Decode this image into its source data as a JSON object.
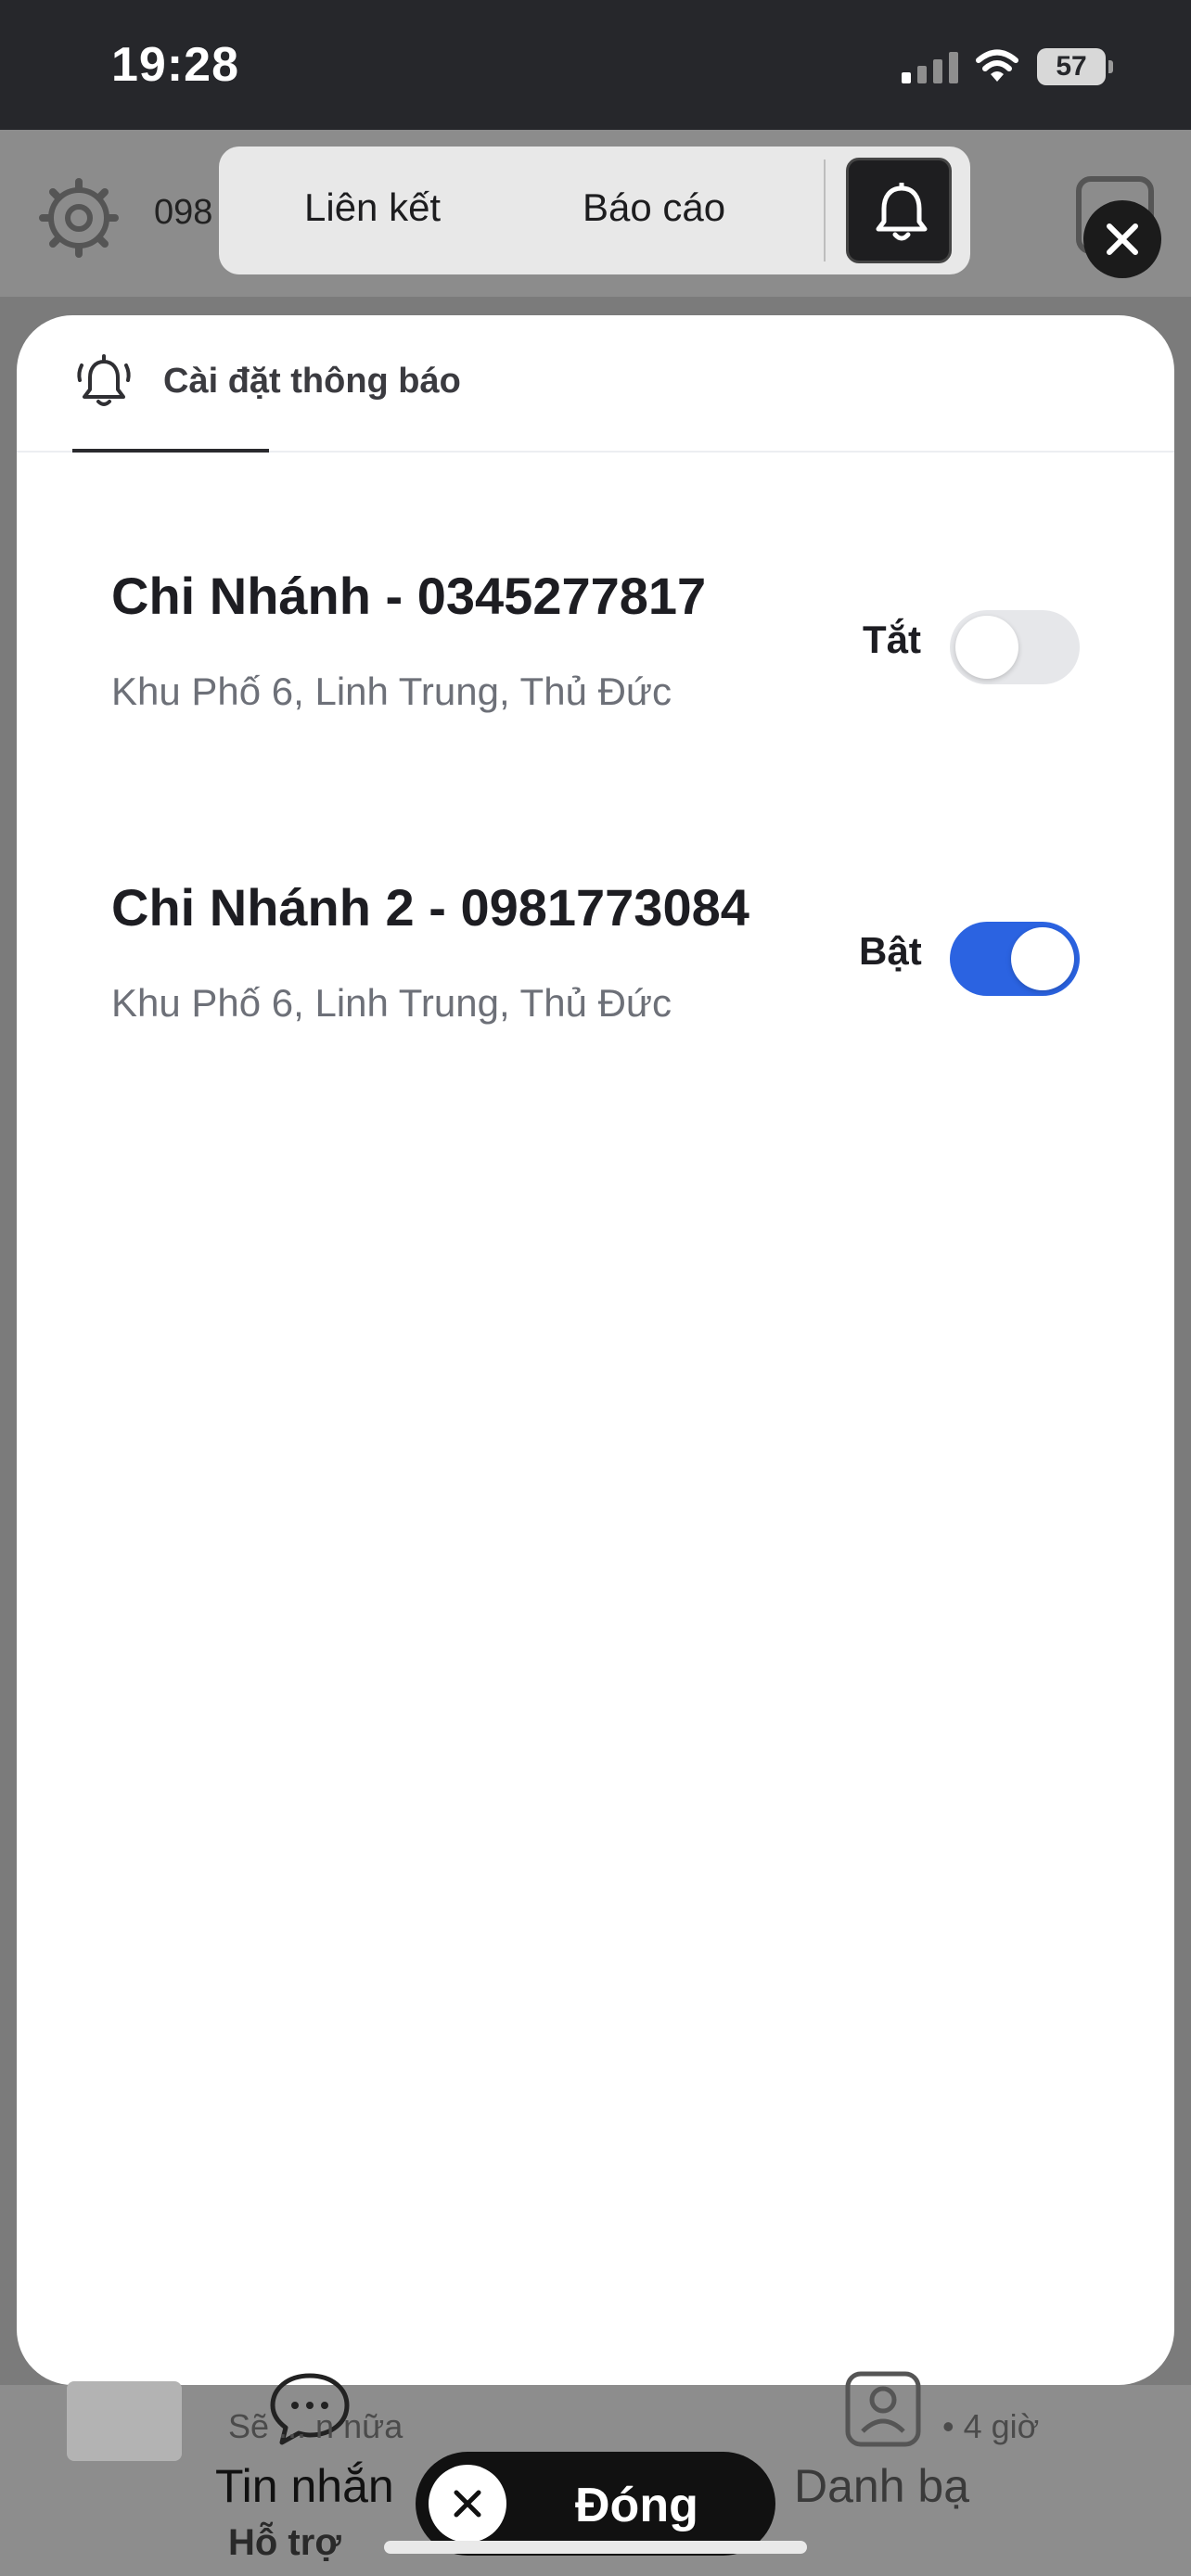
{
  "status_bar": {
    "time": "19:28",
    "battery": "57"
  },
  "background": {
    "phone_prefix": "098",
    "subtitle": "Sẽ ... n nữa",
    "time_ago": "• 4 giờ",
    "nav_messages": "Tin nhắn",
    "nav_contacts": "Danh bạ",
    "support": "Hỗ trợ"
  },
  "top_tabs": {
    "link": "Liên kết",
    "report": "Báo cáo"
  },
  "sheet": {
    "tab_label": "Cài đặt thông báo",
    "branches": [
      {
        "name": "Chi Nhánh - 0345277817",
        "address": "Khu Phố 6, Linh Trung, Thủ Đức",
        "toggle_label": "Tắt",
        "enabled": false
      },
      {
        "name": "Chi Nhánh 2 - 0981773084",
        "address": "Khu Phố 6, Linh Trung, Thủ Đức",
        "toggle_label": "Bật",
        "enabled": true
      }
    ]
  },
  "close_button": {
    "label": "Đóng"
  },
  "colors": {
    "toggle_on": "#2b63e1",
    "toggle_off": "#e6e7ea"
  }
}
